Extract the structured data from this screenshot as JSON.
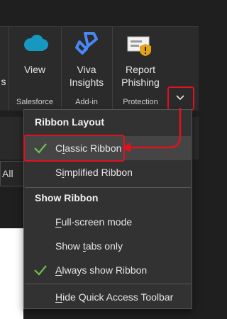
{
  "ribbon": {
    "partial_left_label": "s",
    "view_label": "View",
    "viva_line1": "Viva",
    "viva_line2": "Insights",
    "report_line1": "Report",
    "report_line2": "Phishing",
    "group_salesforce": "Salesforce",
    "group_addin": "Add-in",
    "group_protection": "Protection",
    "collapse_icon": "chevron-down-icon"
  },
  "background": {
    "partial_tab_label": "All"
  },
  "menu": {
    "header_layout": "Ribbon Layout",
    "classic": {
      "pre": "C",
      "accel": "l",
      "post": "assic Ribbon",
      "checked": true
    },
    "simplified": {
      "pre": "S",
      "accel": "i",
      "post": "mplified Ribbon"
    },
    "header_show": "Show Ribbon",
    "fullscreen": {
      "pre": "",
      "accel": "F",
      "post": "ull-screen mode"
    },
    "tabsonly": {
      "pre": "Show ",
      "accel": "t",
      "post": "abs only"
    },
    "always": {
      "pre": "",
      "accel": "A",
      "post": "lways show Ribbon",
      "checked": true
    },
    "hideqat": {
      "pre": "",
      "accel": "H",
      "post": "ide Quick Access Toolbar"
    }
  },
  "colors": {
    "annotation": "#e0121e",
    "check": "#6cc24a",
    "menu_bg": "#323232"
  }
}
